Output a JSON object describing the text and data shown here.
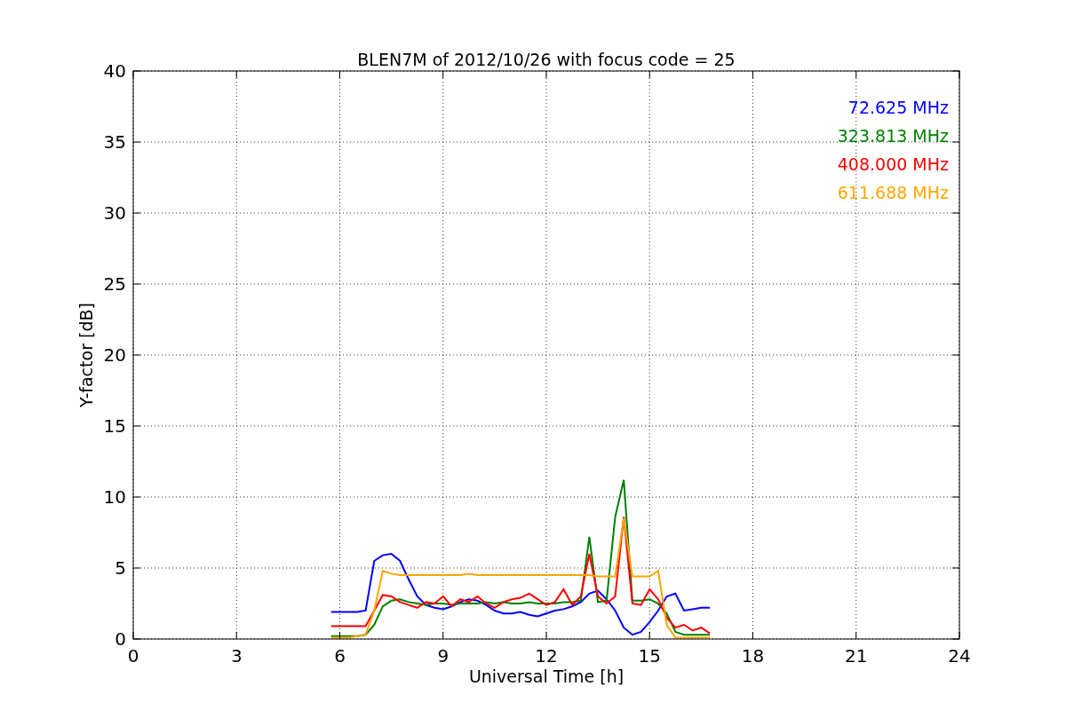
{
  "chart_data": {
    "type": "line",
    "title": "BLEN7M of 2012/10/26 with focus code = 25",
    "xlabel": "Universal Time [h]",
    "ylabel": "Y-factor [dB]",
    "x": [
      5.75,
      6,
      6.25,
      6.5,
      6.75,
      7,
      7.25,
      7.5,
      7.75,
      8,
      8.25,
      8.5,
      8.75,
      9,
      9.25,
      9.5,
      9.75,
      10,
      10.25,
      10.5,
      10.75,
      11,
      11.25,
      11.5,
      11.75,
      12,
      12.25,
      12.5,
      12.75,
      13,
      13.25,
      13.5,
      13.75,
      14,
      14.25,
      14.5,
      14.75,
      15,
      15.25,
      15.5,
      15.75,
      16,
      16.25,
      16.5,
      16.75
    ],
    "series": [
      {
        "name": "72.625 MHz",
        "color": "#0000ff",
        "values": [
          1.9,
          1.9,
          1.9,
          1.9,
          2.0,
          5.5,
          5.9,
          6.0,
          5.5,
          4.2,
          3.0,
          2.4,
          2.2,
          2.1,
          2.3,
          2.6,
          2.8,
          2.7,
          2.4,
          2.0,
          1.8,
          1.8,
          1.9,
          1.7,
          1.6,
          1.8,
          2.0,
          2.1,
          2.3,
          2.6,
          3.2,
          3.4,
          2.8,
          2.0,
          0.8,
          0.3,
          0.5,
          1.2,
          2.0,
          3.0,
          3.2,
          2.0,
          2.1,
          2.2,
          2.2
        ]
      },
      {
        "name": "323.813 MHz",
        "color": "#008000",
        "values": [
          0.2,
          0.2,
          0.2,
          0.2,
          0.3,
          1.0,
          2.3,
          2.7,
          2.8,
          2.6,
          2.5,
          2.4,
          2.5,
          2.5,
          2.4,
          2.5,
          2.5,
          2.5,
          2.6,
          2.5,
          2.6,
          2.5,
          2.5,
          2.6,
          2.5,
          2.5,
          2.5,
          2.6,
          2.6,
          2.7,
          7.2,
          2.6,
          2.7,
          8.6,
          11.2,
          2.7,
          2.7,
          2.8,
          2.5,
          1.8,
          0.5,
          0.3,
          0.3,
          0.3,
          0.3
        ]
      },
      {
        "name": "408.000 MHz",
        "color": "#ff0000",
        "values": [
          0.9,
          0.9,
          0.9,
          0.9,
          0.9,
          2.0,
          3.1,
          3.0,
          2.6,
          2.4,
          2.2,
          2.6,
          2.5,
          3.0,
          2.3,
          2.8,
          2.6,
          3.0,
          2.5,
          2.2,
          2.6,
          2.8,
          2.9,
          3.2,
          2.8,
          2.4,
          2.6,
          3.5,
          2.4,
          3.0,
          6.0,
          3.0,
          2.5,
          3.0,
          8.6,
          2.5,
          2.4,
          3.5,
          2.8,
          1.5,
          0.8,
          1.0,
          0.6,
          0.8,
          0.4
        ]
      },
      {
        "name": "611.688 MHz",
        "color": "#ffa500",
        "values": [
          0.1,
          0.1,
          0.1,
          0.2,
          0.3,
          2.0,
          4.8,
          4.6,
          4.5,
          4.5,
          4.5,
          4.5,
          4.5,
          4.5,
          4.5,
          4.5,
          4.6,
          4.5,
          4.5,
          4.5,
          4.5,
          4.5,
          4.5,
          4.5,
          4.5,
          4.5,
          4.5,
          4.5,
          4.5,
          4.5,
          4.5,
          4.4,
          4.4,
          4.4,
          8.5,
          4.4,
          4.4,
          4.4,
          4.8,
          1.0,
          0.1,
          0.1,
          0.1,
          0.1,
          0.1
        ]
      }
    ],
    "xlim": [
      0,
      24
    ],
    "ylim": [
      0,
      40
    ],
    "xticks": [
      0,
      3,
      6,
      9,
      12,
      15,
      18,
      21,
      24
    ],
    "yticks": [
      0,
      5,
      10,
      15,
      20,
      25,
      30,
      35,
      40
    ],
    "grid": true
  }
}
